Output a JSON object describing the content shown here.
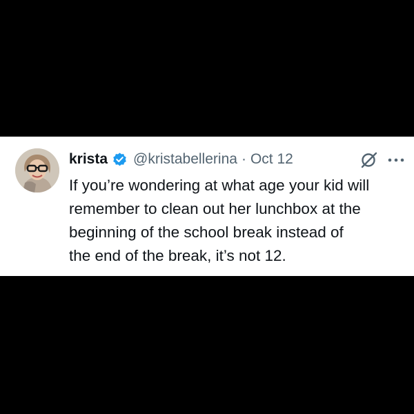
{
  "tweet": {
    "author": {
      "display_name": "krista",
      "handle": "@kristabellerina",
      "verified": true,
      "avatar_icon": "avatar-photo"
    },
    "separator": "·",
    "date": "Oct 12",
    "body_lines": [
      "If you’re wondering at what age your kid will",
      "remember to clean out her lunchbox at the",
      "beginning of the school break instead of",
      "the end of the break, it’s not 12."
    ],
    "icons": {
      "verified": "verified-badge-icon",
      "grok": "grok-icon",
      "more": "more-options-icon"
    },
    "colors": {
      "verified_blue": "#1d9bf0",
      "text_primary": "#0f1419",
      "text_secondary": "#536471",
      "background": "#000000",
      "card": "#ffffff"
    }
  }
}
